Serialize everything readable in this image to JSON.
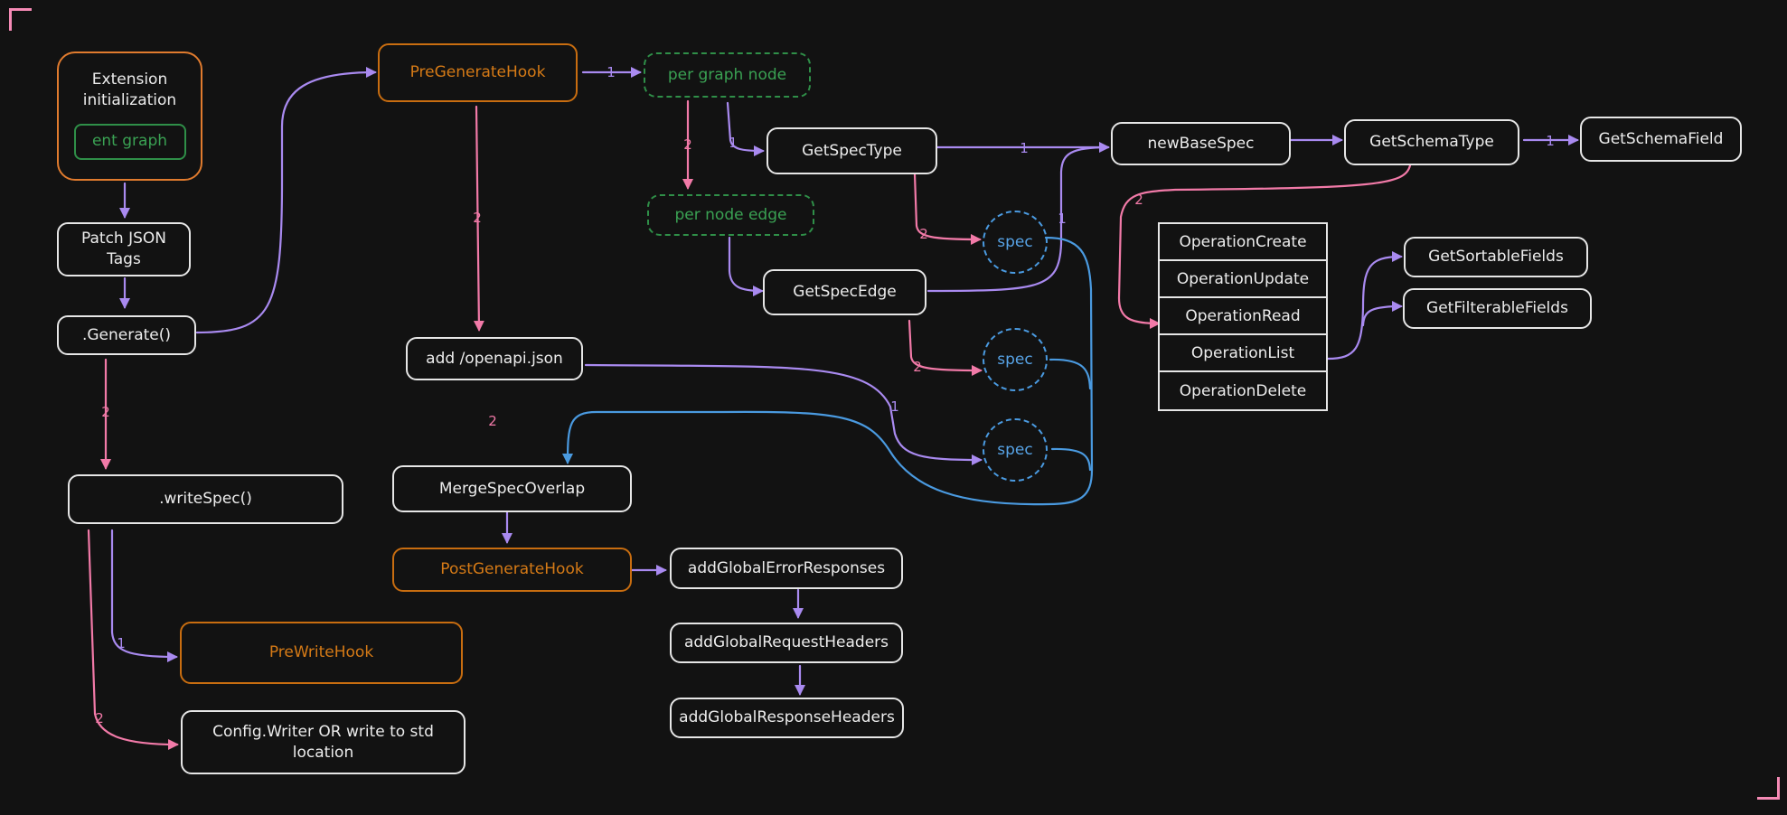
{
  "colors": {
    "background": "#121212",
    "node_border": "#e6e6e6",
    "hook": "#d57a16",
    "init_border": "#e07b2e",
    "group_green": "#3aa153",
    "spec_blue": "#57a3e6",
    "edge_purple": "#a98af0",
    "edge_pink": "#f27aa8",
    "edge_blue": "#4a9ae0",
    "corner_pink": "#f58ab5"
  },
  "nodes": {
    "ext_init": "Extension initialization",
    "ent_graph": "ent graph",
    "patch_json_tags": "Patch JSON Tags",
    "generate": ".Generate()",
    "write_spec": ".writeSpec()",
    "pre_write_hook": "PreWriteHook",
    "config_writer": "Config.Writer OR write to std location",
    "pre_generate_hook": "PreGenerateHook",
    "per_graph_node": "per graph node",
    "per_node_edge": "per node edge",
    "get_spec_type": "GetSpecType",
    "get_spec_edge": "GetSpecEdge",
    "spec_1": "spec",
    "spec_2": "spec",
    "spec_3": "spec",
    "add_openapi_json": "add /openapi.json",
    "merge_spec_overlap": "MergeSpecOverlap",
    "post_generate_hook": "PostGenerateHook",
    "add_global_error_responses": "addGlobalErrorResponses",
    "add_global_request_headers": "addGlobalRequestHeaders",
    "add_global_response_headers": "addGlobalResponseHeaders",
    "new_base_spec": "newBaseSpec",
    "get_schema_type": "GetSchemaType",
    "get_schema_field": "GetSchemaField",
    "get_sortable_fields": "GetSortableFields",
    "get_filterable_fields": "GetFilterableFields"
  },
  "operations": [
    "OperationCreate",
    "OperationUpdate",
    "OperationRead",
    "OperationList",
    "OperationDelete"
  ],
  "edge_labels": {
    "one": "1",
    "two": "2"
  },
  "edges": [
    {
      "from": "ext_init",
      "to": "patch_json_tags",
      "color": "purple",
      "label": ""
    },
    {
      "from": "patch_json_tags",
      "to": "generate",
      "color": "purple",
      "label": ""
    },
    {
      "from": "generate",
      "to": "pre_generate_hook",
      "color": "purple",
      "label": ""
    },
    {
      "from": "generate",
      "to": "write_spec",
      "color": "pink",
      "label": "2"
    },
    {
      "from": "write_spec",
      "to": "pre_write_hook",
      "color": "purple",
      "label": "1"
    },
    {
      "from": "write_spec",
      "to": "config_writer",
      "color": "pink",
      "label": "2"
    },
    {
      "from": "pre_generate_hook",
      "to": "per_graph_node",
      "color": "purple",
      "label": "1"
    },
    {
      "from": "pre_generate_hook",
      "to": "add_openapi_json",
      "color": "pink",
      "label": "2"
    },
    {
      "from": "per_graph_node",
      "to": "get_spec_type",
      "color": "purple",
      "label": "1"
    },
    {
      "from": "per_graph_node",
      "to": "per_node_edge",
      "color": "pink",
      "label": "2"
    },
    {
      "from": "per_node_edge",
      "to": "get_spec_edge",
      "color": "purple",
      "label": ""
    },
    {
      "from": "get_spec_type",
      "to": "new_base_spec",
      "color": "purple",
      "label": "1"
    },
    {
      "from": "get_spec_type",
      "to": "spec_1",
      "color": "pink",
      "label": "2"
    },
    {
      "from": "get_spec_edge",
      "to": "new_base_spec",
      "color": "purple",
      "label": "1"
    },
    {
      "from": "get_spec_edge",
      "to": "spec_2",
      "color": "pink",
      "label": "2"
    },
    {
      "from": "add_openapi_json",
      "to": "spec_3",
      "color": "purple",
      "label": "1"
    },
    {
      "from": "add_openapi_json",
      "to": "merge_spec_overlap",
      "color": "pink",
      "label": "2"
    },
    {
      "from": "spec_1",
      "to": "merge_spec_overlap",
      "color": "blue",
      "label": ""
    },
    {
      "from": "spec_2",
      "to": "merge_spec_overlap",
      "color": "blue",
      "label": ""
    },
    {
      "from": "spec_3",
      "to": "merge_spec_overlap",
      "color": "blue",
      "label": ""
    },
    {
      "from": "merge_spec_overlap",
      "to": "post_generate_hook",
      "color": "purple",
      "label": ""
    },
    {
      "from": "post_generate_hook",
      "to": "add_global_error_responses",
      "color": "purple",
      "label": ""
    },
    {
      "from": "add_global_error_responses",
      "to": "add_global_request_headers",
      "color": "purple",
      "label": ""
    },
    {
      "from": "add_global_request_headers",
      "to": "add_global_response_headers",
      "color": "purple",
      "label": ""
    },
    {
      "from": "new_base_spec",
      "to": "get_schema_type",
      "color": "purple",
      "label": ""
    },
    {
      "from": "get_schema_type",
      "to": "get_schema_field",
      "color": "purple",
      "label": "1"
    },
    {
      "from": "get_schema_type",
      "to": "operation_read",
      "color": "pink",
      "label": "2"
    },
    {
      "from": "operation_list",
      "to": "get_sortable_fields",
      "color": "purple",
      "label": ""
    },
    {
      "from": "operation_list",
      "to": "get_filterable_fields",
      "color": "purple",
      "label": ""
    }
  ]
}
